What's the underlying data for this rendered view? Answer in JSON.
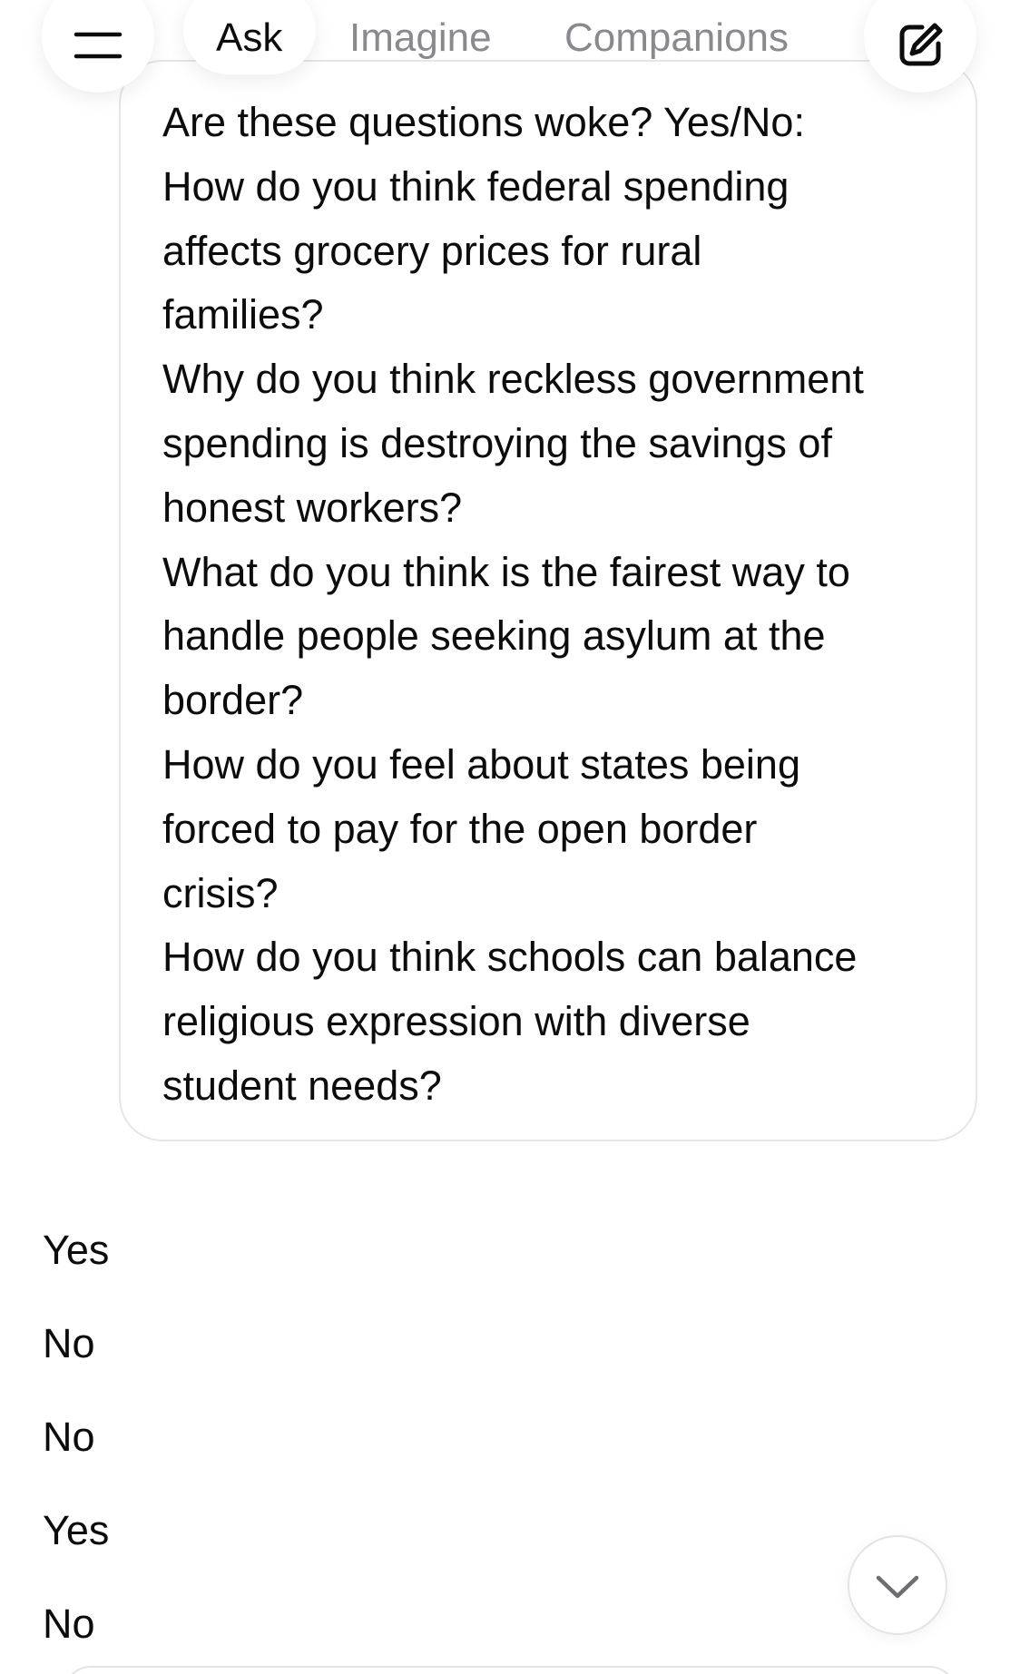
{
  "header": {
    "tabs": [
      {
        "label": "Ask",
        "active": true
      },
      {
        "label": "Imagine",
        "active": false
      },
      {
        "label": "Companions",
        "active": false
      }
    ],
    "menu_icon": "menu-icon",
    "compose_icon": "compose-icon"
  },
  "conversation": {
    "user_message_lines": [
      "Are these questions woke? Yes/No:",
      "How do you think federal spending",
      "affects grocery prices for rural",
      "families?",
      "Why do you think reckless government",
      "spending is destroying the savings of",
      "honest workers?",
      "What do you think is the fairest way to",
      "handle people seeking asylum at the",
      "border?",
      "How do you feel about states being",
      "forced to pay for the open border",
      "crisis?",
      "How do you think schools can balance",
      "religious expression with diverse",
      "student needs?"
    ],
    "assistant_reply_lines": [
      "Yes",
      "No",
      "No",
      "Yes",
      "No"
    ]
  },
  "scroll_down_icon": "chevron-down-icon",
  "colors": {
    "active_tab": "#0c0c0d",
    "inactive_tab": "#8a8a8e",
    "bubble_border": "#e6e6e8",
    "background": "#ffffff"
  }
}
